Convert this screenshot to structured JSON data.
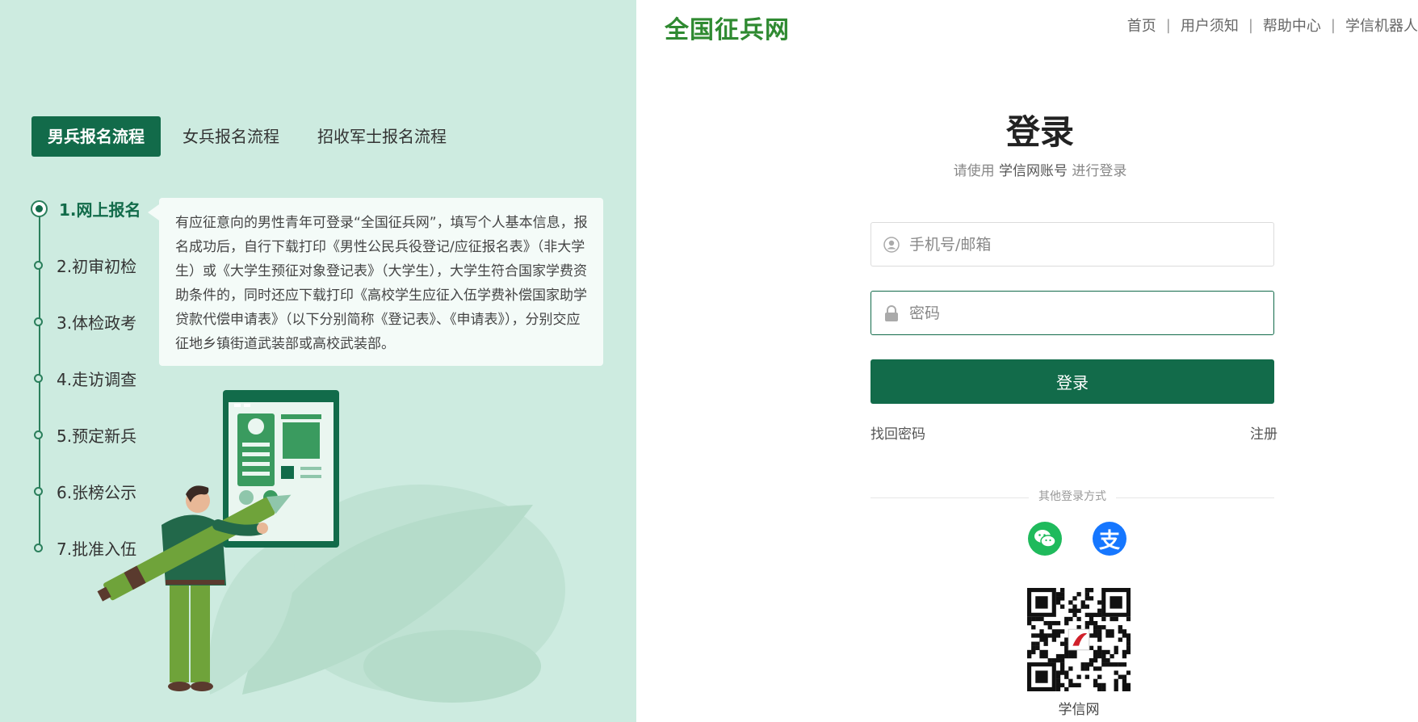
{
  "left": {
    "tabs": [
      {
        "label": "男兵报名流程",
        "active": true
      },
      {
        "label": "女兵报名流程",
        "active": false
      },
      {
        "label": "招收军士报名流程",
        "active": false
      }
    ],
    "steps": [
      {
        "label": "1.网上报名",
        "active": true
      },
      {
        "label": "2.初审初检",
        "active": false
      },
      {
        "label": "3.体检政考",
        "active": false
      },
      {
        "label": "4.走访调查",
        "active": false
      },
      {
        "label": "5.预定新兵",
        "active": false
      },
      {
        "label": "6.张榜公示",
        "active": false
      },
      {
        "label": "7.批准入伍",
        "active": false
      }
    ],
    "description": "有应征意向的男性青年可登录“全国征兵网”，填写个人基本信息，报名成功后，自行下载打印《男性公民兵役登记/应征报名表》（非大学生）或《大学生预征对象登记表》（大学生），大学生符合国家学费资助条件的，同时还应下载打印《高校学生应征入伍学费补偿国家助学贷款代偿申请表》（以下分别简称《登记表》、《申请表》），分别交应征地乡镇街道武装部或高校武装部。"
  },
  "header": {
    "logo": "全国征兵网",
    "nav": [
      "首页",
      "用户须知",
      "帮助中心",
      "学信机器人"
    ],
    "separator": "|"
  },
  "login": {
    "title": "登录",
    "subtitle_prefix": "请使用",
    "subtitle_account": "学信网账号",
    "subtitle_suffix": "进行登录",
    "username_placeholder": "手机号/邮箱",
    "password_placeholder": "密码",
    "submit_label": "登录",
    "forgot_label": "找回密码",
    "register_label": "注册",
    "other_methods_label": "其他登录方式",
    "alipay_glyph": "支",
    "qr_label": "学信网"
  },
  "colors": {
    "brand_green": "#126b4a",
    "logo_green": "#2f8a31",
    "left_bg": "#cdebe0",
    "wechat": "#1fba5c",
    "alipay": "#1677ff"
  },
  "icons": [
    "user-icon",
    "lock-icon",
    "wechat-icon",
    "alipay-icon",
    "qr-code"
  ]
}
